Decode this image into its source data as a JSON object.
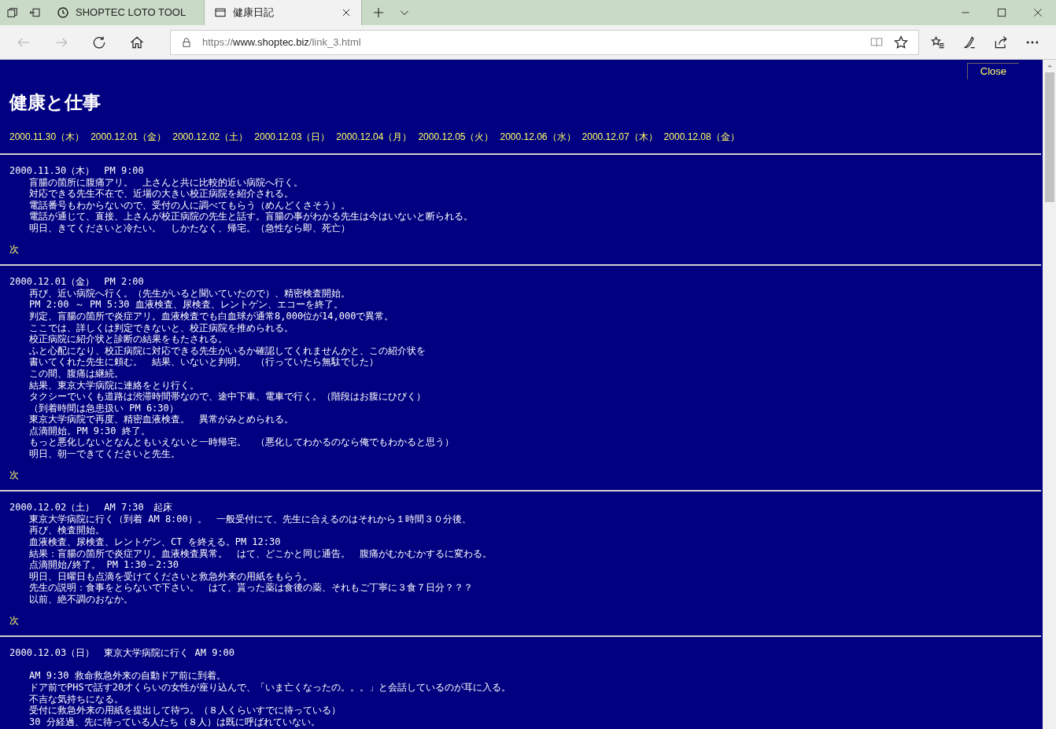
{
  "browser": {
    "tabs": [
      {
        "title": "SHOPTEC LOTO TOOL",
        "selected": false
      },
      {
        "title": "健康日記",
        "selected": true
      }
    ],
    "address": {
      "scheme": "https://",
      "host": "www.shoptec.biz",
      "path": "/link_3.html"
    },
    "forward_disabled": true
  },
  "page": {
    "close_link": "Close",
    "title": "健康と仕事",
    "date_links": [
      "2000.11.30（木）",
      "2000.12.01（金）",
      "2000.12.02（土）",
      "2000.12.03（日）",
      "2000.12.04（月）",
      "2000.12.05（火）",
      "2000.12.06（水）",
      "2000.12.07（木）",
      "2000.12.08（金）"
    ],
    "entries": [
      {
        "heading": "2000.11.30（木）　PM 9:00",
        "gap_after_heading": false,
        "next_link": "次",
        "lines": [
          "盲腸の箇所に腹痛アリ。　上さんと共に比較的近い病院へ行く。",
          "対応できる先生不在で、近場の大きい校正病院を紹介される。",
          "電話番号もわからないので、受付の人に調べてもらう（めんどくさそう）。",
          "電話が通じて、直接、上さんが校正病院の先生と話す。盲腸の事がわかる先生は今はいないと断られる。",
          "明日、きてくださいと冷たい。　しかたなく、帰宅。（急性なら即、死亡）"
        ]
      },
      {
        "heading": "2000.12.01（金）　PM 2:00",
        "gap_after_heading": false,
        "next_link": "次",
        "lines": [
          "再び、近い病院へ行く。（先生がいると聞いていたので）、精密検査開始。",
          "PM 2:00 ～ PM 5:30 血液検査、尿検査、レントゲン、エコーを終了。",
          "判定、盲腸の箇所で炎症アリ。血液検査でも白血球が通常8,000位が14,000で異常。",
          "ここでは、詳しくは判定できないと、校正病院を推められる。",
          "校正病院に紹介状と診断の結果をもたされる。",
          "ふと心配になり、校正病院に対応できる先生がいるか確認してくれませんかと、この紹介状を",
          "書いてくれた先生に頼む。　結果、いないと判明。　（行っていたら無駄でした）",
          "この間、腹痛は継続。",
          "結果、東京大学病院に連絡をとり行く。",
          "タクシーでいくも道路は渋滞時間帯なので、途中下車、電車で行く。（階段はお腹にひびく）",
          "（到着時間は急患扱い PM 6:30）",
          "東京大学病院で再度、精密血液検査。　異常がみとめられる。",
          "点滴開始。PM 9:30 終了。",
          "もっと悪化しないとなんともいえないと一時帰宅。　（悪化してわかるのなら俺でもわかると思う）",
          "明日、朝一できてくださいと先生。"
        ]
      },
      {
        "heading": "2000.12.02（土）　AM 7:30　起床",
        "gap_after_heading": false,
        "next_link": "次",
        "lines": [
          "東京大学病院に行く（到着 AM 8:00）。　一般受付にて、先生に合えるのはそれから１時間３０分後、",
          "再び、検査開始。",
          "血液検査、尿検査、レントゲン、CT を終える。PM 12:30",
          "結果：盲腸の箇所で炎症アリ。血液検査異常。　はて、どこかと同じ通告。　腹痛がむかむかするに変わる。",
          "点滴開始/終了。 PM 1:30－2:30",
          "明日、日曜日も点滴を受けてくださいと救急外来の用紙をもらう。",
          "先生の説明：食事をとらないで下さい。　はて、貰った薬は食後の薬、それもご丁寧に３食７日分？？？",
          "以前、絶不調のおなか。"
        ]
      },
      {
        "heading": "2000.12.03（日）　東京大学病院に行く AM 9:00",
        "gap_after_heading": true,
        "lines": [
          "AM 9:30 救命救急外来の自動ドア前に到着。",
          "ドア前でPHSで話す20才くらいの女性が座り込んで、「いま亡くなったの。。。」と会話しているのが耳に入る。",
          "不吉な気持ちになる。",
          "受付に救急外来の用紙を提出して待つ。（８人くらいすでに待っている）",
          "30 分経過、先に待っている人たち（８人）は既に呼ばれていない。"
        ]
      }
    ]
  }
}
